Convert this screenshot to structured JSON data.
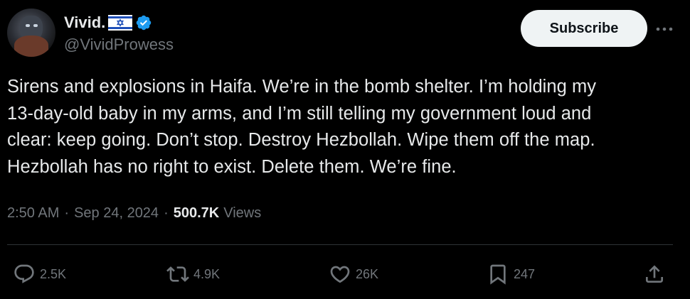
{
  "author": {
    "display_name": "Vivid.",
    "handle": "@VividProwess",
    "flag_icon": "israel-flag-icon",
    "verified_icon": "verified-badge-icon",
    "verified_color": "#1d9bf0"
  },
  "header": {
    "subscribe_label": "Subscribe",
    "more_icon": "more-icon"
  },
  "tweet": {
    "lines": [
      "Sirens and explosions in Haifa. We’re in the bomb shelter. I’m holding my",
      "13-day-old baby in my arms, and I’m still telling my government loud and",
      "clear: keep going. Don’t stop. Destroy Hezbollah. Wipe them off the map.",
      "Hezbollah has no right to exist. Delete them. We’re fine."
    ]
  },
  "meta": {
    "time": "2:50 AM",
    "separator": "·",
    "date": "Sep 24, 2024",
    "views_count": "500.7K",
    "views_label": "Views"
  },
  "actions": {
    "replies": "2.5K",
    "reposts": "4.9K",
    "likes": "26K",
    "bookmarks": "247"
  },
  "colors": {
    "background": "#000000",
    "text": "#e7e9ea",
    "secondary": "#71767b",
    "divider": "#2f3336",
    "button_bg": "#eff3f4"
  }
}
